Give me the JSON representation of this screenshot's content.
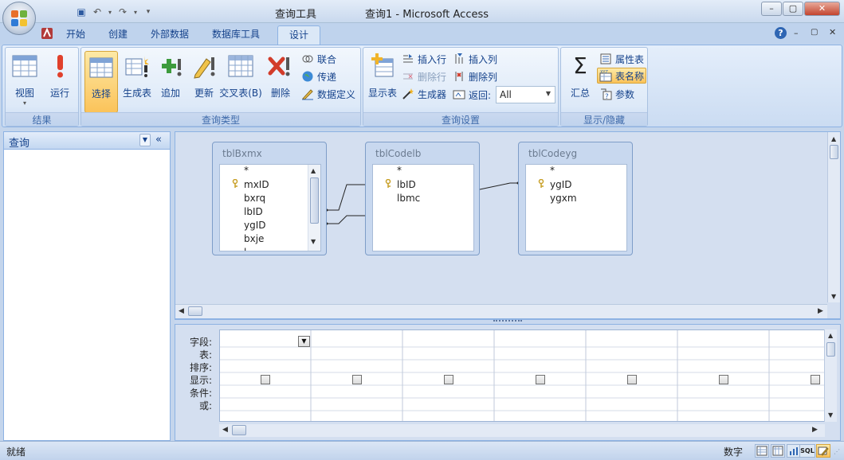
{
  "window": {
    "tool_title": "查询工具",
    "app_title": "查询1 - Microsoft Access",
    "help": "?",
    "minimize": "–",
    "restore": "▢",
    "close": "✕"
  },
  "tabs": [
    "开始",
    "创建",
    "外部数据",
    "数据库工具",
    "设计"
  ],
  "ribbon": {
    "results": {
      "label": "结果",
      "view": "视图",
      "run": "运行"
    },
    "query_type": {
      "label": "查询类型",
      "select": "选择",
      "make_table": "生成表",
      "append": "追加",
      "update": "更新",
      "crosstab": "交叉表(B)",
      "delete": "删除",
      "union": "联合",
      "pass_through": "传递",
      "data_definition": "数据定义"
    },
    "query_setup": {
      "label": "查询设置",
      "show_table": "显示表",
      "insert_rows": "插入行",
      "delete_rows": "删除行",
      "builder": "生成器",
      "insert_columns": "插入列",
      "delete_columns": "删除列",
      "return_label": "返回:",
      "return_value": "All"
    },
    "show_hide": {
      "label": "显示/隐藏",
      "totals": "汇总",
      "property_sheet": "属性表",
      "table_names": "表名称",
      "parameters": "参数"
    }
  },
  "nav": {
    "title": "查询"
  },
  "tables": [
    {
      "name": "tblBxmx",
      "fields": [
        "*",
        "mxID",
        "bxrq",
        "lbID",
        "ygID",
        "bxje",
        "l"
      ]
    },
    {
      "name": "tblCodelb",
      "fields": [
        "*",
        "lbID",
        "lbmc"
      ]
    },
    {
      "name": "tblCodeyg",
      "fields": [
        "*",
        "ygID",
        "ygxm"
      ]
    }
  ],
  "grid_rows": [
    "字段:",
    "表:",
    "排序:",
    "显示:",
    "条件:",
    "或:"
  ],
  "status": {
    "left": "就绪",
    "mode": "数字",
    "sql": "SQL"
  },
  "colors": {
    "accent": "#15428b",
    "ribbon_bg": "#dbe8f7",
    "selected": "#fbc35a"
  }
}
